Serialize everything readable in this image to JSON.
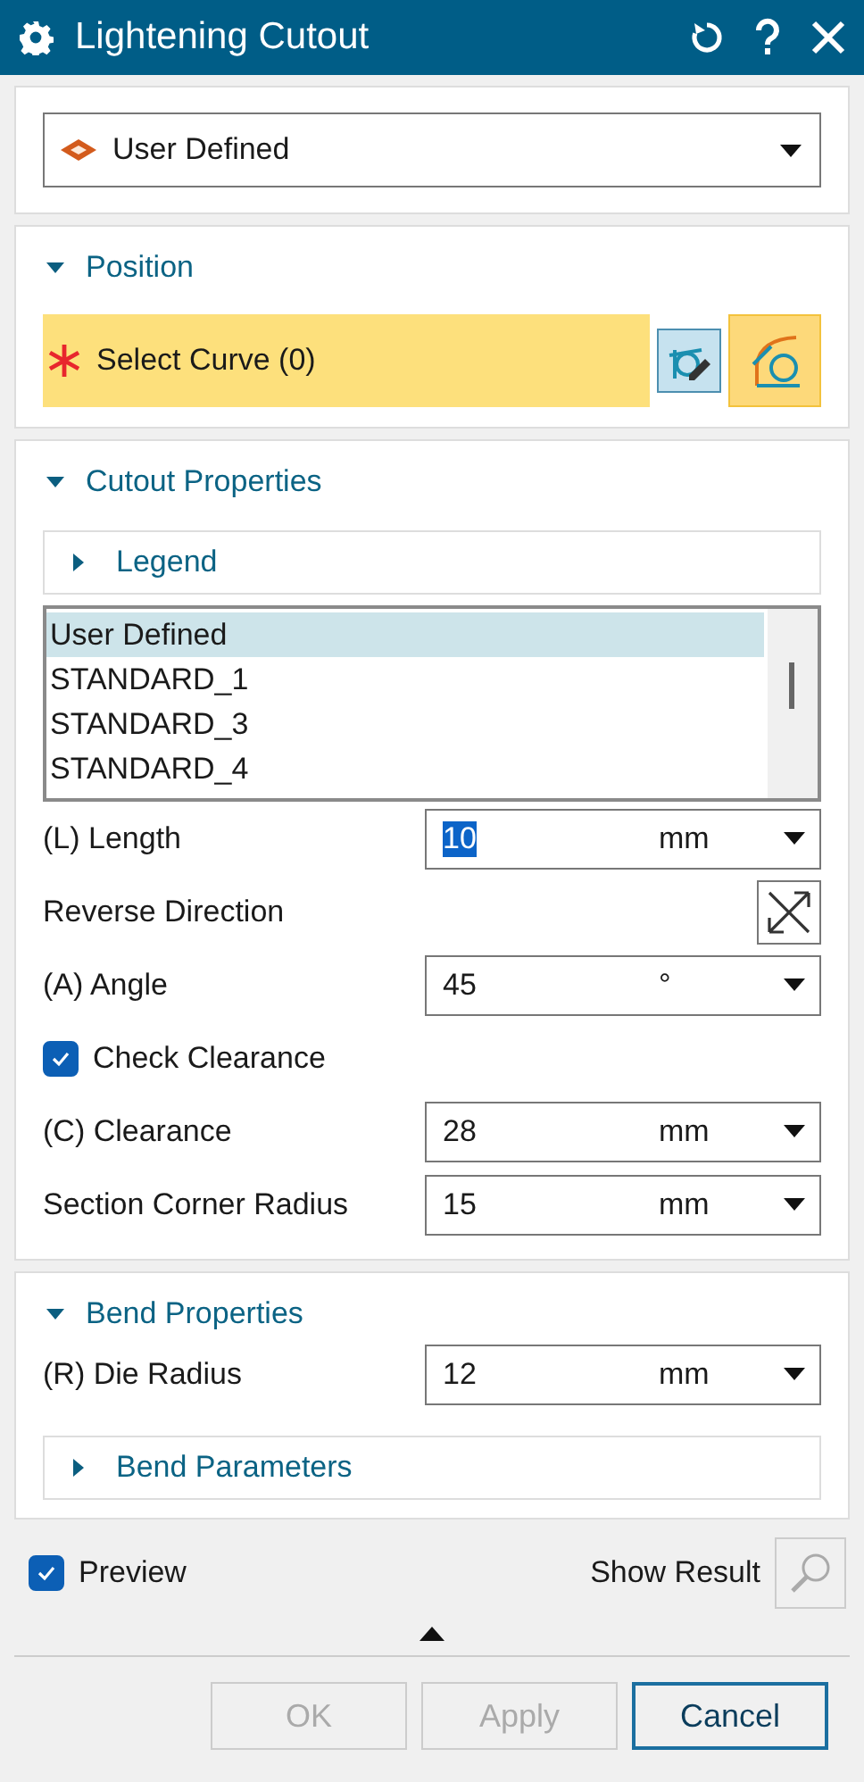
{
  "window": {
    "title": "Lightening Cutout"
  },
  "type_dropdown": {
    "value": "User Defined"
  },
  "position": {
    "title": "Position",
    "expanded": true,
    "selector": {
      "label": "Select Curve (0)",
      "required": true
    }
  },
  "cutout_properties": {
    "title": "Cutout Properties",
    "expanded": true,
    "legend": {
      "title": "Legend",
      "expanded": false
    },
    "list": [
      {
        "label": "User Defined",
        "selected": true
      },
      {
        "label": "STANDARD_1",
        "selected": false
      },
      {
        "label": "STANDARD_3",
        "selected": false
      },
      {
        "label": "STANDARD_4",
        "selected": false
      }
    ],
    "fields": [
      {
        "kind": "dimension",
        "label": "(L) Length",
        "value": "10",
        "unit": "mm",
        "highlighted": true
      },
      {
        "kind": "toggle",
        "label": "Reverse Direction"
      },
      {
        "kind": "dimension",
        "label": "(A) Angle",
        "value": "45",
        "unit": "°",
        "highlighted": false
      },
      {
        "kind": "checkbox",
        "label": "Check Clearance",
        "checked": true
      },
      {
        "kind": "dimension",
        "label": "(C) Clearance",
        "value": "28",
        "unit": "mm",
        "highlighted": false
      },
      {
        "kind": "dimension",
        "label": "Section Corner Radius",
        "value": "15",
        "unit": "mm",
        "highlighted": false
      }
    ]
  },
  "bend_properties": {
    "title": "Bend Properties",
    "expanded": true,
    "fields": [
      {
        "kind": "dimension",
        "label": "(R) Die Radius",
        "value": "12",
        "unit": "mm",
        "highlighted": false
      }
    ],
    "subsection": {
      "title": "Bend Parameters",
      "expanded": false
    }
  },
  "preview": {
    "label": "Preview",
    "checked": true
  },
  "show_result": {
    "label": "Show Result"
  },
  "buttons": [
    {
      "label": "OK",
      "disabled": true,
      "default": false
    },
    {
      "label": "Apply",
      "disabled": true,
      "default": false
    },
    {
      "label": "Cancel",
      "disabled": false,
      "default": true
    }
  ]
}
